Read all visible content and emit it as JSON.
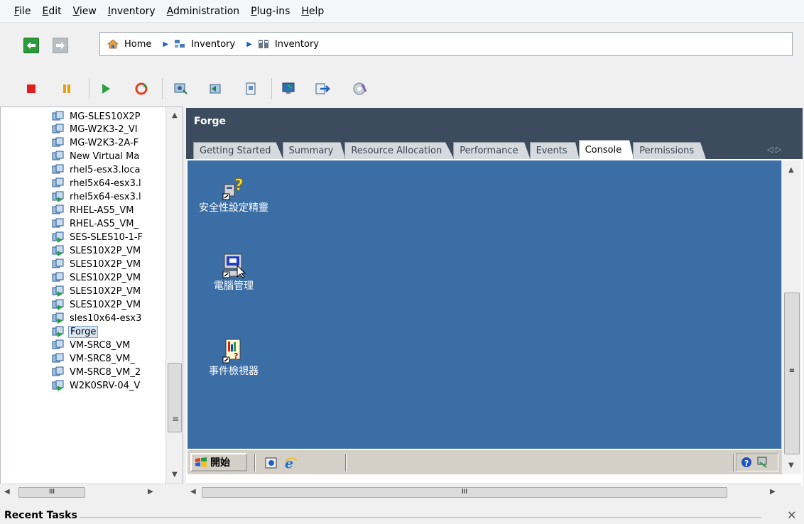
{
  "menu": [
    "File",
    "Edit",
    "View",
    "Inventory",
    "Administration",
    "Plug-ins",
    "Help"
  ],
  "breadcrumb": [
    {
      "label": "Home",
      "icon": "home-icon"
    },
    {
      "label": "Inventory",
      "icon": "hosts-clusters-icon"
    },
    {
      "label": "Inventory",
      "icon": "vms-templates-icon"
    }
  ],
  "toolbar": {
    "icons": [
      "power-off-icon",
      "suspend-icon",
      "power-on-icon",
      "reset-icon",
      "snapshot-take-icon",
      "snapshot-revert-icon",
      "snapshot-manager-icon",
      "console-icon",
      "migrate-icon",
      "vm-tools-icon"
    ]
  },
  "tree": {
    "items": [
      "MG-SLES10X2P",
      "MG-W2K3-2_VI",
      "MG-W2K3-2A-F",
      "New Virtual Ma",
      "rhel5-esx3.loca",
      "rhel5x64-esx3.l",
      "rhel5x64-esx3.l",
      "RHEL-AS5_VM",
      "RHEL-AS5_VM_",
      "SES-SLES10-1-F",
      "SLES10X2P_VM",
      "SLES10X2P_VM",
      "SLES10X2P_VM",
      "SLES10X2P_VM",
      "SLES10X2P_VM",
      "sles10x64-esx3",
      "Forge",
      "VM-SRC8_VM",
      "VM-SRC8_VM_",
      "VM-SRC8_VM_2",
      "W2K0SRV-04_V"
    ],
    "selected": "Forge"
  },
  "panel": {
    "title": "Forge",
    "tabs": [
      "Getting Started",
      "Summary",
      "Resource Allocation",
      "Performance",
      "Events",
      "Console",
      "Permissions"
    ],
    "active_tab": "Console"
  },
  "console": {
    "icons": [
      {
        "label": "安全性設定精靈",
        "icon": "security-wizard-icon"
      },
      {
        "label": "電腦管理",
        "icon": "computer-management-icon"
      },
      {
        "label": "事件檢視器",
        "icon": "event-viewer-icon"
      }
    ],
    "start_label": "開始",
    "desktop_color": "#3a6ea5"
  },
  "recent_tasks": {
    "title": "Recent Tasks"
  },
  "scroll_marks": {
    "grip": "≡",
    "hgrip": "III"
  }
}
